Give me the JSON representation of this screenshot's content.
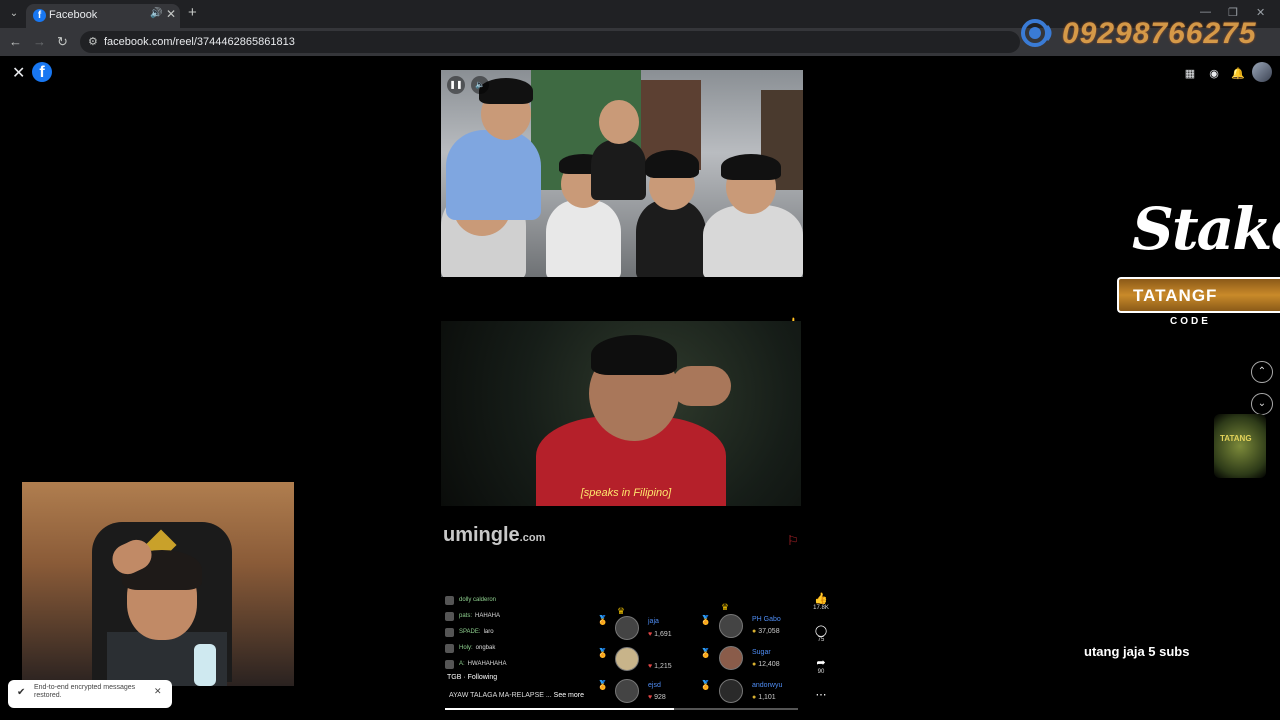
{
  "browser": {
    "tab_title": "Facebook",
    "url": "facebook.com/reel/3744462865861813",
    "new_tab": "+",
    "tab_close": "✕"
  },
  "overlay": {
    "phone": "09298766275",
    "stake_brand": "Stake",
    "promo_code": "TATANGF",
    "promo_label": "CODE",
    "subs_note": "utang jaja  5 subs",
    "sticker_text": "TATANG"
  },
  "reel": {
    "subtitle": "[speaks in Filipino]",
    "watermark": "umingle",
    "watermark_suffix": ".com",
    "owner": "TGB",
    "following": "· Following",
    "caption": "AYAW TALAGA MA-RELAPSE ...",
    "see_more": "See more",
    "progress": 0.65,
    "likes": "17.8K",
    "comments": "75",
    "shares": "90"
  },
  "chat": [
    {
      "name": "dolly calderon",
      "msg": ""
    },
    {
      "name": "pats:",
      "msg": "HAHAHA"
    },
    {
      "name": "SPADE:",
      "msg": "laro"
    },
    {
      "name": "Holy:",
      "msg": "ongbak"
    },
    {
      "name": "A:",
      "msg": "HWAHAHAHA"
    }
  ],
  "gifters": [
    {
      "name": "jaja",
      "value": "1,691"
    },
    {
      "name": "PH Gabo",
      "value": "37,058"
    },
    {
      "name": "",
      "value": "1,215"
    },
    {
      "name": "Sugar",
      "value": "12,408"
    },
    {
      "name": "ejsd",
      "value": "928"
    },
    {
      "name": "andorwyu",
      "value": "1,101"
    }
  ],
  "toast": {
    "message": "End-to-end encrypted messages restored."
  }
}
